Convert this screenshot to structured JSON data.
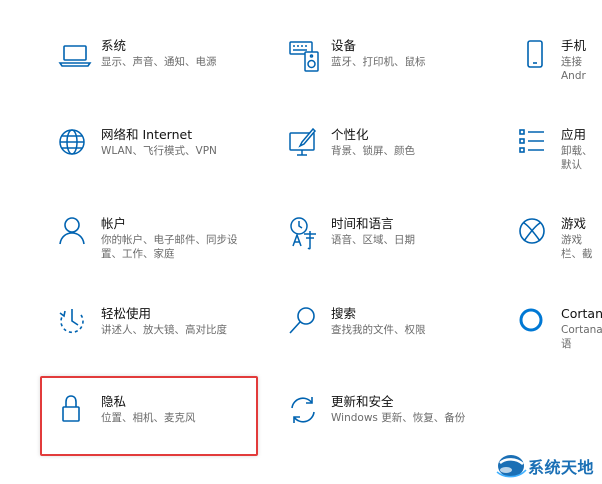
{
  "settings": {
    "items": [
      {
        "title": "系统",
        "desc": "显示、声音、通知、电源",
        "icon": "laptop-icon"
      },
      {
        "title": "设备",
        "desc": "蓝牙、打印机、鼠标",
        "icon": "keyboard-speaker-icon"
      },
      {
        "title": "手机",
        "desc": "连接 Andr",
        "icon": "phone-icon"
      },
      {
        "title": "网络和 Internet",
        "desc": "WLAN、飞行模式、VPN",
        "icon": "globe-icon"
      },
      {
        "title": "个性化",
        "desc": "背景、锁屏、颜色",
        "icon": "paint-brush-monitor-icon"
      },
      {
        "title": "应用",
        "desc": "卸载、默认",
        "icon": "app-list-icon"
      },
      {
        "title": "帐户",
        "desc": "你的帐户、电子邮件、同步设\n置、工作、家庭",
        "icon": "person-icon"
      },
      {
        "title": "时间和语言",
        "desc": "语音、区域、日期",
        "icon": "time-language-icon"
      },
      {
        "title": "游戏",
        "desc": "游戏栏、截",
        "icon": "xbox-icon"
      },
      {
        "title": "轻松使用",
        "desc": "讲述人、放大镜、高对比度",
        "icon": "ease-of-access-icon"
      },
      {
        "title": "搜索",
        "desc": "查找我的文件、权限",
        "icon": "search-icon"
      },
      {
        "title": "Cortana",
        "desc": "Cortana 语",
        "icon": "cortana-ring-icon"
      },
      {
        "title": "隐私",
        "desc": "位置、相机、麦克风",
        "icon": "lock-icon"
      },
      {
        "title": "更新和安全",
        "desc": "Windows 更新、恢复、备份",
        "icon": "sync-arrows-icon"
      }
    ]
  },
  "watermark": {
    "text": "系统天地"
  },
  "colors": {
    "accent": "#0063b1",
    "highlight_border": "#e23b3b",
    "desc_text": "#6b6b6b"
  }
}
